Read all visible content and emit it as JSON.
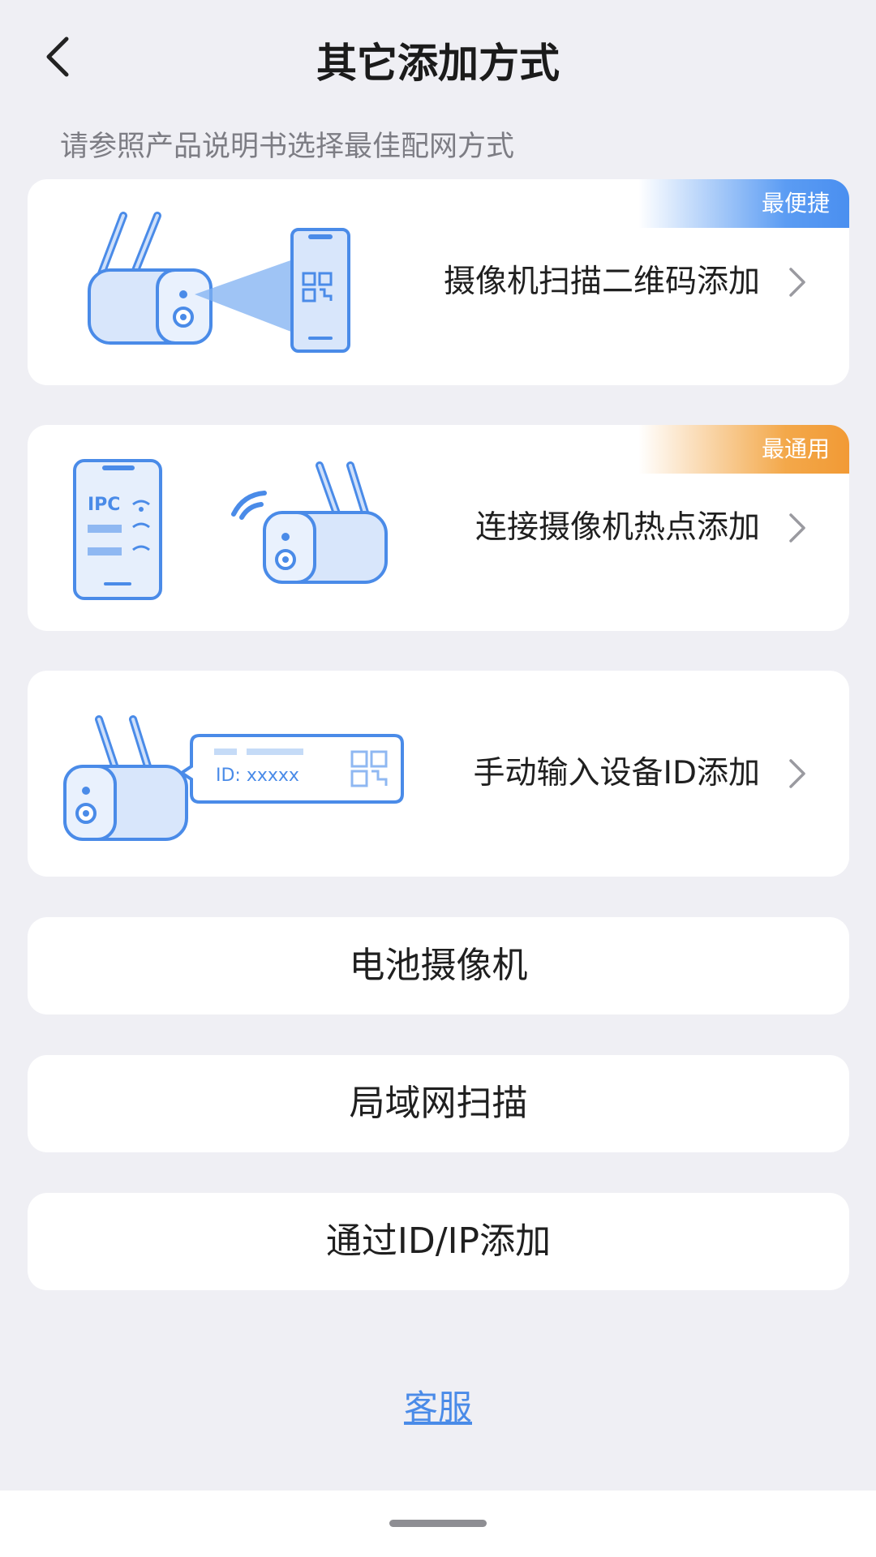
{
  "header": {
    "title": "其它添加方式"
  },
  "subtitle": "请参照产品说明书选择最佳配网方式",
  "options": [
    {
      "label": "摄像机扫描二维码添加",
      "badge": "最便捷",
      "badge_color": "#5b9cf3"
    },
    {
      "label": "连接摄像机热点添加",
      "badge": "最通用",
      "badge_color": "#f3a84a"
    },
    {
      "label": "手动输入设备ID添加",
      "id_text": "ID: xxxxx"
    }
  ],
  "phone_label": "IPC",
  "buttons": [
    {
      "label": "电池摄像机"
    },
    {
      "label": "局域网扫描"
    },
    {
      "label": "通过ID/IP添加"
    }
  ],
  "service_link": "客服",
  "accent_color": "#4a8be8"
}
